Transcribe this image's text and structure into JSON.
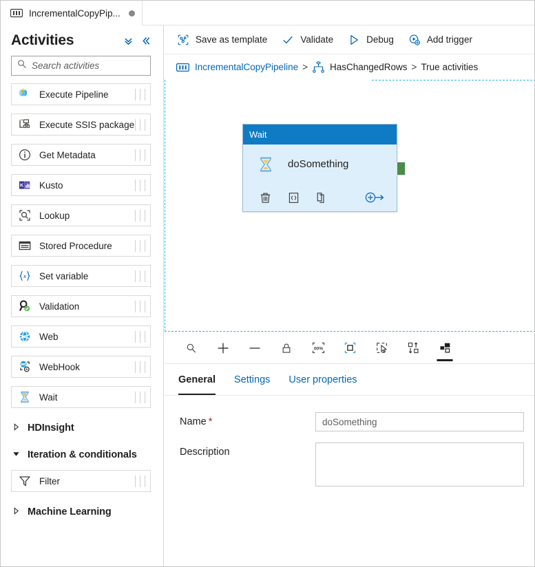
{
  "tab": {
    "icon": "pipeline-icon",
    "label": "IncrementalCopyPip...",
    "dirty_dot": "unsaved-indicator"
  },
  "sidebar": {
    "title": "Activities",
    "collapse_all_icon": "double-chevron-down-icon",
    "collapse_panel_icon": "double-chevron-left-icon",
    "search": {
      "placeholder": "Search activities",
      "value": "",
      "icon": "search-icon"
    },
    "items": [
      {
        "label": "Execute Pipeline",
        "icon": "execute-pipeline-icon"
      },
      {
        "label": "Execute SSIS package",
        "icon": "execute-ssis-package-icon"
      },
      {
        "label": "Get Metadata",
        "icon": "get-metadata-icon"
      },
      {
        "label": "Kusto",
        "icon": "kusto-icon"
      },
      {
        "label": "Lookup",
        "icon": "lookup-icon"
      },
      {
        "label": "Stored Procedure",
        "icon": "stored-procedure-icon"
      },
      {
        "label": "Set variable",
        "icon": "set-variable-icon"
      },
      {
        "label": "Validation",
        "icon": "validation-icon"
      },
      {
        "label": "Web",
        "icon": "web-icon"
      },
      {
        "label": "WebHook",
        "icon": "webhook-icon"
      },
      {
        "label": "Wait",
        "icon": "wait-icon"
      }
    ],
    "groups": [
      {
        "label": "HDInsight",
        "expanded": false
      },
      {
        "label": "Iteration & conditionals",
        "expanded": true
      },
      {
        "label": "Machine Learning",
        "expanded": false
      }
    ],
    "group_items": [
      {
        "label": "Filter",
        "icon": "filter-icon"
      }
    ]
  },
  "commandbar": {
    "save_as_template": "Save as template",
    "validate": "Validate",
    "debug": "Debug",
    "add_trigger": "Add trigger"
  },
  "breadcrumb": {
    "pipeline": "IncrementalCopyPipeline",
    "sep1": ">",
    "activity": "HasChangedRows",
    "sep2": ">",
    "branch": "True activities"
  },
  "canvas": {
    "node": {
      "type": "Wait",
      "name": "doSomething",
      "icon": "hourglass-icon",
      "actions": [
        {
          "name": "delete-icon"
        },
        {
          "name": "code-icon"
        },
        {
          "name": "clone-icon"
        },
        {
          "name": "add-output-icon"
        }
      ],
      "output_connector": "success-output-connector"
    },
    "toolbar": [
      {
        "name": "zoom-icon",
        "selected": false
      },
      {
        "name": "zoom-in-icon",
        "selected": false
      },
      {
        "name": "zoom-out-icon",
        "selected": false
      },
      {
        "name": "lock-icon",
        "selected": false
      },
      {
        "name": "zoom-100-icon",
        "selected": false
      },
      {
        "name": "zoom-to-fit-icon",
        "selected": false
      },
      {
        "name": "marquee-select-icon",
        "selected": false
      },
      {
        "name": "auto-align-icon",
        "selected": false
      },
      {
        "name": "layout-icon",
        "selected": true
      }
    ]
  },
  "properties": {
    "tabs": [
      {
        "label": "General",
        "active": true
      },
      {
        "label": "Settings",
        "active": false
      },
      {
        "label": "User properties",
        "active": false
      }
    ],
    "fields": {
      "name_label": "Name",
      "name_required": "*",
      "name_value": "doSomething",
      "name_placeholder": "",
      "description_label": "Description",
      "description_value": "",
      "description_placeholder": ""
    }
  },
  "colors": {
    "accent": "#0067b8",
    "node_header": "#0f7bc4",
    "node_body": "#deeffc",
    "success_connector": "#4b8b4b",
    "required_asterisk": "#a4262c",
    "canvas_border": "#27b6ea"
  }
}
